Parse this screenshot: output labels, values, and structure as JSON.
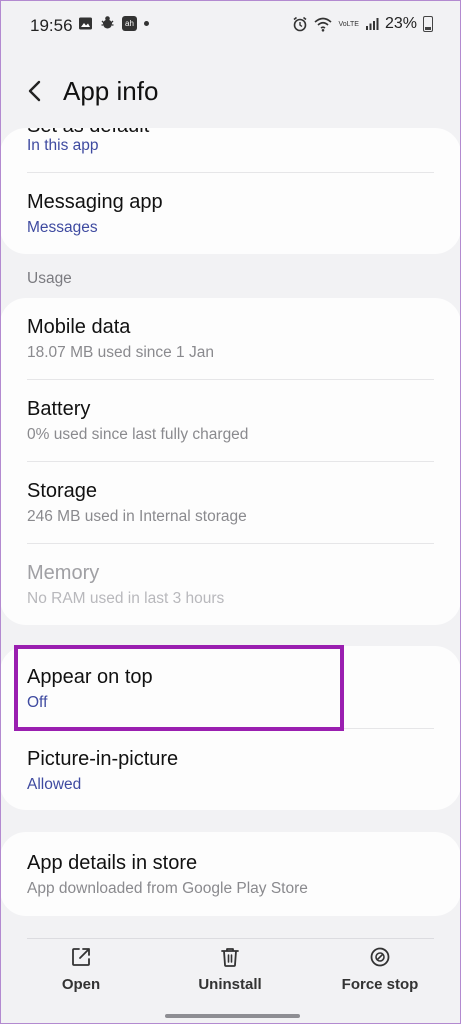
{
  "status_bar": {
    "time": "19:56",
    "left_icons": [
      "image-icon",
      "bug-icon",
      "app-badge-icon",
      "dot"
    ],
    "badge_text": "ah",
    "right_icons": [
      "alarm-icon",
      "wifi-icon",
      "volte-lte-icon",
      "signal-icon"
    ],
    "network_text": "VoLTE",
    "battery_percent": "23%"
  },
  "header": {
    "title": "App info",
    "back_icon": "chevron-left-icon"
  },
  "defaults_card": {
    "partial_title": "Set as default",
    "partial_sub": "In this app",
    "messaging_title": "Messaging app",
    "messaging_sub": "Messages"
  },
  "usage": {
    "section_label": "Usage",
    "items": [
      {
        "title": "Mobile data",
        "sub": "18.07 MB used since 1 Jan"
      },
      {
        "title": "Battery",
        "sub": "0% used since last fully charged"
      },
      {
        "title": "Storage",
        "sub": "246 MB used in Internal storage"
      },
      {
        "title": "Memory",
        "sub": "No RAM used in last 3 hours",
        "disabled": true
      }
    ]
  },
  "permissions_card": {
    "items": [
      {
        "title": "Appear on top",
        "sub": "Off"
      },
      {
        "title": "Picture-in-picture",
        "sub": "Allowed"
      }
    ]
  },
  "store_card": {
    "title": "App details in store",
    "sub": "App downloaded from Google Play Store"
  },
  "bottom_actions": [
    {
      "label": "Open",
      "icon": "open-external-icon"
    },
    {
      "label": "Uninstall",
      "icon": "trash-icon"
    },
    {
      "label": "Force stop",
      "icon": "block-icon"
    }
  ],
  "colors": {
    "background": "#f2f2f4",
    "card": "#fdfdfd",
    "link_blue": "#3e4aa0",
    "highlight": "#9a1fb0"
  }
}
